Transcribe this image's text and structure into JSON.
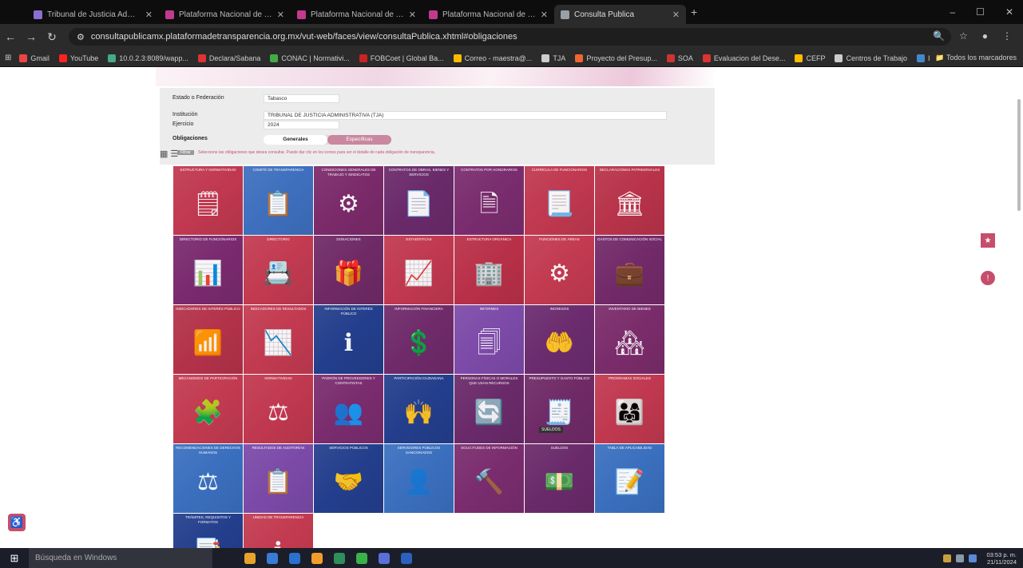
{
  "browser": {
    "tabs": [
      {
        "label": "Tribunal de Justicia Administr...",
        "color": "#8a6fd1",
        "active": false
      },
      {
        "label": "Plataforma Nacional de Transp...",
        "color": "#c13a8f",
        "active": false
      },
      {
        "label": "Plataforma Nacional de Transp...",
        "color": "#c13a8f",
        "active": false
      },
      {
        "label": "Plataforma Nacional de Transp...",
        "color": "#c13a8f",
        "active": false
      },
      {
        "label": "Consulta Publica",
        "color": "#9aa0a6",
        "active": true
      }
    ],
    "new_tab": "+",
    "url": "consultapublicamx.plataformadetransparencia.org.mx/vut-web/faces/view/consultaPublica.xhtml#obligaciones",
    "bookmarks": [
      {
        "label": "Gmail",
        "color": "#e44"
      },
      {
        "label": "YouTube",
        "color": "#f22"
      },
      {
        "label": "10.0.2.3:8089/wapp...",
        "color": "#4a8"
      },
      {
        "label": "Declara/Sabana",
        "color": "#d33"
      },
      {
        "label": "CONAC | Normativi...",
        "color": "#4a4"
      },
      {
        "label": "FOBCoet | Global Ba...",
        "color": "#c22"
      },
      {
        "label": "Correo - maestra@...",
        "color": "#fb0"
      },
      {
        "label": "TJA",
        "color": "#ccc"
      },
      {
        "label": "Proyecto del Presup...",
        "color": "#e63"
      },
      {
        "label": "SOA",
        "color": "#c33"
      },
      {
        "label": "Evaluacion del Dese...",
        "color": "#d33"
      },
      {
        "label": "CEFP",
        "color": "#fb0"
      },
      {
        "label": "Centros de Trabajo",
        "color": "#ccc"
      },
      {
        "label": "Inicio - PNT",
        "color": "#48c"
      }
    ],
    "all_bookmarks": "Todos los marcadores"
  },
  "form": {
    "estado_label": "Estado o Federación",
    "estado_value": "Tabasco",
    "institucion_label": "Institución",
    "institucion_value": "TRIBUNAL DE JUSTICIA ADMINISTRATIVA (TJA)",
    "ejercicio_label": "Ejercicio",
    "ejercicio_value": "2024",
    "obligaciones_label": "Obligaciones",
    "toggle_generales": "Generales",
    "toggle_especificas": "Específicas",
    "hint_button": "Filtrar",
    "hint_text": "Seleccione las obligaciones que desea consultar. Puede dar clic en los iconos para ver el detalle de cada obligación de transparencia."
  },
  "tiles": [
    {
      "label": "Estructura y Normatividad",
      "color": "#c0384f",
      "icon": "🗒"
    },
    {
      "label": "Comité de Transparencia",
      "color": "#3e6fbe",
      "icon": "📋"
    },
    {
      "label": "Condiciones Generales de Trabajo y Sindicatos",
      "color": "#7b2a6a",
      "icon": "⚙"
    },
    {
      "label": "Contratos de Obras, Bienes y Servicios",
      "color": "#6a2a6a",
      "icon": "📄"
    },
    {
      "label": "Contratos por Honorarios",
      "color": "#7a2c6e",
      "icon": "🗎"
    },
    {
      "label": "Currícula de Funcionarios",
      "color": "#c0384f",
      "icon": "📃"
    },
    {
      "label": "Declaraciones Patrimoniales",
      "color": "#b8334a",
      "icon": "🏛"
    },
    {
      "label": "Directorio de Funcionarios",
      "color": "#7a2a6f",
      "icon": "📊"
    },
    {
      "label": "Directorio",
      "color": "#c23a50",
      "icon": "📇"
    },
    {
      "label": "Donaciones",
      "color": "#6f2a66",
      "icon": "🎁"
    },
    {
      "label": "Estadísticas",
      "color": "#c0384f",
      "icon": "📈"
    },
    {
      "label": "Estructura Orgánica",
      "color": "#b83048",
      "icon": "🏢"
    },
    {
      "label": "Funciones de Áreas",
      "color": "#c23a50",
      "icon": "⚙"
    },
    {
      "label": "Gastos de Comunicación Social",
      "color": "#722a69",
      "icon": "💼"
    },
    {
      "label": "Indicadores de Interés Público",
      "color": "#b3324a",
      "icon": "📶"
    },
    {
      "label": "Indicadores de Resultados",
      "color": "#c23a50",
      "icon": "📉"
    },
    {
      "label": "Información de Interés Público",
      "color": "#233e8c",
      "icon": "ℹ"
    },
    {
      "label": "Información Financiera",
      "color": "#6f2a6a",
      "icon": "💲"
    },
    {
      "label": "Informes",
      "color": "#7c4aa8",
      "icon": "🗐"
    },
    {
      "label": "Ingresos",
      "color": "#6b2b6e",
      "icon": "🤲"
    },
    {
      "label": "Inventario de Bienes",
      "color": "#7a2c6a",
      "icon": "🏘"
    },
    {
      "label": "Mecanismos de Participación",
      "color": "#c23a50",
      "icon": "🧩"
    },
    {
      "label": "Normatividad",
      "color": "#c0384f",
      "icon": "⚖"
    },
    {
      "label": "Padrón de Proveedores y Contratistas",
      "color": "#7a2c6e",
      "icon": "👥"
    },
    {
      "label": "Participación Ciudadana",
      "color": "#233e8c",
      "icon": "🙌"
    },
    {
      "label": "Personas Físicas o Morales que usan Recursos",
      "color": "#6a2a6a",
      "icon": "🔄"
    },
    {
      "label": "Presupuesto y Gasto Público",
      "color": "#6f2a66",
      "icon": "🧾"
    },
    {
      "label": "Programas Sociales",
      "color": "#c0384f",
      "icon": "👨‍👩‍👧"
    },
    {
      "label": "Recomendaciones de Derechos Humanos",
      "color": "#3a6fbe",
      "icon": "⚖"
    },
    {
      "label": "Resultados de Auditorías",
      "color": "#7b4aa8",
      "icon": "📋"
    },
    {
      "label": "Servicios Públicos",
      "color": "#233e8c",
      "icon": "🤝"
    },
    {
      "label": "Servidores Públicos Sancionados",
      "color": "#3a6fbe",
      "icon": "👤"
    },
    {
      "label": "Solicitudes de Información",
      "color": "#7a2c6e",
      "icon": "🔨"
    },
    {
      "label": "Sueldos",
      "color": "#6a2a6a",
      "icon": "💵"
    },
    {
      "label": "Tabla de Aplicabilidad",
      "color": "#3a6fbe",
      "icon": "📝"
    },
    {
      "label": "Trámites, Requisitos y Formatos",
      "color": "#233e8c",
      "icon": "📑"
    },
    {
      "label": "Unidad de Transparencia",
      "color": "#c23a50",
      "icon": "ℹ"
    }
  ],
  "tooltip": "SUELDOS",
  "side_buttons": {
    "favorite": "★",
    "alert": "!"
  },
  "taskbar": {
    "search_placeholder": "Búsqueda en Windows",
    "time": "03:53 p. m.",
    "date": "21/11/2024",
    "apps": [
      "#e7a32b",
      "#3a7bd5",
      "#2b6fd1",
      "#f29d2b",
      "#2f8f5b",
      "#3bb14a",
      "#5a6fd8",
      "#2d5fbf"
    ]
  }
}
